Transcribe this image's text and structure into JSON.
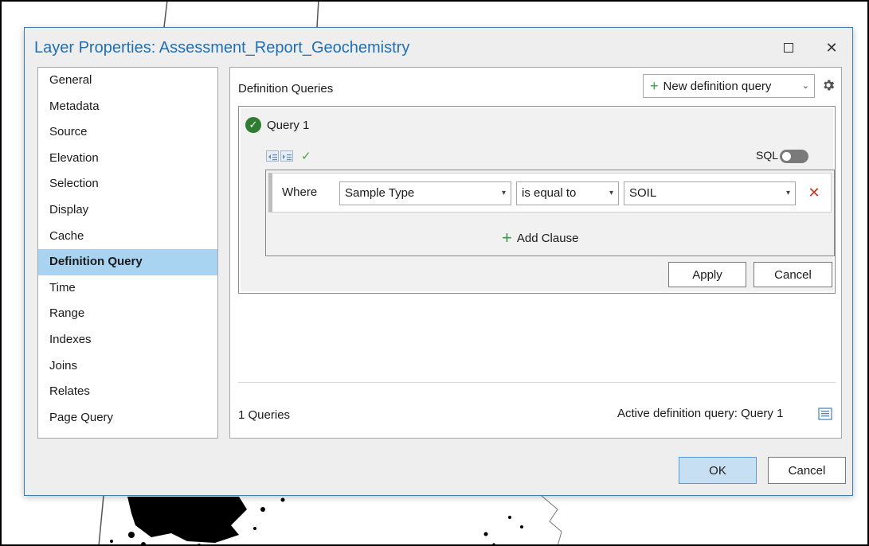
{
  "dialog": {
    "title": "Layer Properties: Assessment_Report_Geochemistry",
    "maximize_icon": "maximize-icon",
    "close_icon": "close-icon",
    "close_glyph": "✕"
  },
  "nav": {
    "items": [
      {
        "label": "General"
      },
      {
        "label": "Metadata"
      },
      {
        "label": "Source"
      },
      {
        "label": "Elevation"
      },
      {
        "label": "Selection"
      },
      {
        "label": "Display"
      },
      {
        "label": "Cache"
      },
      {
        "label": "Definition Query",
        "selected": true
      },
      {
        "label": "Time"
      },
      {
        "label": "Range"
      },
      {
        "label": "Indexes"
      },
      {
        "label": "Joins"
      },
      {
        "label": "Relates"
      },
      {
        "label": "Page Query"
      }
    ]
  },
  "main": {
    "panel_title": "Definition Queries",
    "new_query_label": "New definition query",
    "plus_glyph": "+",
    "chevron_glyph": "⌄",
    "query": {
      "name": "Query 1",
      "check_glyph": "✓",
      "sql_label": "SQL",
      "sql_enabled": false,
      "clause": {
        "where_label": "Where",
        "field": "Sample Type",
        "operator": "is equal to",
        "value": "SOIL",
        "dropdown_glyph": "▾",
        "delete_glyph": "✕"
      },
      "add_clause_label": "Add Clause",
      "apply_label": "Apply",
      "cancel_label": "Cancel"
    },
    "query_count": "1 Queries",
    "active_query_text": "Active definition query: Query 1"
  },
  "footer": {
    "ok_label": "OK",
    "cancel_label": "Cancel"
  },
  "colors": {
    "accent": "#1f6fb5",
    "selected_nav": "#a9d4f1",
    "success_green": "#2e7d32",
    "delete_red": "#c0392b"
  }
}
